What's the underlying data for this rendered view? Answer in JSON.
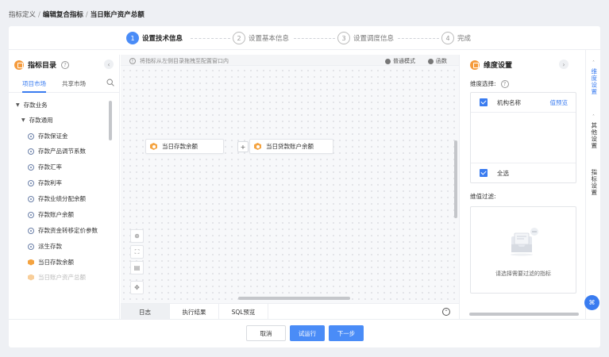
{
  "breadcrumb": {
    "items": [
      "指标定义",
      "编辑复合指标"
    ],
    "current": "当日账户资产总额",
    "sep": "/"
  },
  "steps": [
    {
      "num": "1",
      "label": "设置技术信息",
      "active": true
    },
    {
      "num": "2",
      "label": "设置基本信息",
      "active": false
    },
    {
      "num": "3",
      "label": "设置调度信息",
      "active": false
    },
    {
      "num": "4",
      "label": "完成",
      "active": false
    }
  ],
  "left_panel": {
    "title": "指标目录",
    "help": "?",
    "tabs": [
      "项目市场",
      "共享市场"
    ],
    "tree": [
      {
        "label": "存款业务",
        "level": 0,
        "kind": "folder"
      },
      {
        "label": "存款通用",
        "level": 1,
        "kind": "folder"
      },
      {
        "label": "存款保证金",
        "level": 2,
        "kind": "metric"
      },
      {
        "label": "存款产品调节系数",
        "level": 2,
        "kind": "metric"
      },
      {
        "label": "存款汇率",
        "level": 2,
        "kind": "metric"
      },
      {
        "label": "存款利率",
        "level": 2,
        "kind": "metric"
      },
      {
        "label": "存款业绩分配余额",
        "level": 2,
        "kind": "metric"
      },
      {
        "label": "存款账户余额",
        "level": 2,
        "kind": "metric"
      },
      {
        "label": "存款资金转移定价参数",
        "level": 2,
        "kind": "metric"
      },
      {
        "label": "派生存款",
        "level": 2,
        "kind": "metric"
      },
      {
        "label": "当日存款余额",
        "level": 2,
        "kind": "composite"
      },
      {
        "label": "当日账户资产总额",
        "level": 2,
        "kind": "composite-faded"
      }
    ]
  },
  "canvas": {
    "tip": "将指标从左侧目录拖拽至配置窗口内",
    "modes": [
      "普通模式",
      "函数"
    ],
    "nodes": [
      "当日存款余额",
      "当日贷款账户余额"
    ],
    "operator": "+",
    "bottom_tabs": [
      "日志",
      "执行结果",
      "SQL预览"
    ],
    "tools": [
      "zoom-in-icon",
      "fit-icon",
      "layout-icon",
      "locate-icon"
    ]
  },
  "right_panel": {
    "title": "维度设置",
    "dim_label": "维度选择:",
    "dims": [
      {
        "label": "机构名称",
        "checked": true,
        "preview": "值预览"
      }
    ],
    "select_all": "全选",
    "filter_label": "维值过滤:",
    "filter_empty": "请选择需要过滤的指标"
  },
  "side_tabs": [
    {
      "label": "维度设置",
      "active": true
    },
    {
      "label": "其他设置",
      "active": false
    },
    {
      "label": "指标设置",
      "active": false
    }
  ],
  "footer": {
    "cancel": "取消",
    "trial": "试运行",
    "next": "下一步"
  },
  "colors": {
    "primary": "#4a8cf7",
    "accent_orange": "#f4a340",
    "link": "#3a7cf0"
  }
}
